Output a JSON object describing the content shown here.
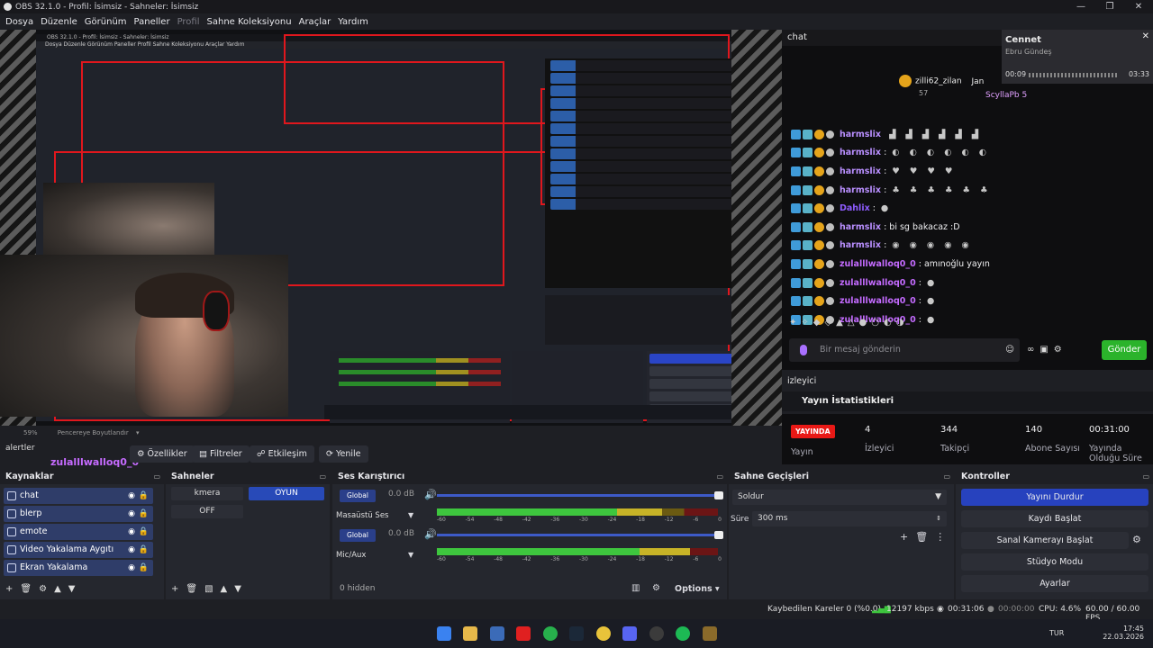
{
  "window": {
    "title": "OBS 32.1.0 - Profil: İsimsiz - Sahneler: İsimsiz",
    "controls": [
      "—",
      "❐",
      "✕"
    ]
  },
  "menu": {
    "items": [
      "Dosya",
      "Düzenle",
      "Görünüm",
      "Paneller",
      "Profil",
      "Sahne Koleksiyonu",
      "Araçlar",
      "Yardım"
    ]
  },
  "preview": {
    "zoom": "59%",
    "zoom_mode": "Pencereye Boyutlandır",
    "nested_title": "OBS 32.1.0 - Profil: İsimsiz - Sahneler: İsimsiz",
    "nested_menu": "Dosya  Düzenle  Görünüm  Paneller  Profil  Sahne Koleksiyonu  Araçlar  Yardım"
  },
  "chat": {
    "header": "chat",
    "popup": {
      "name": "Cennet",
      "artist": "Ebru Gündeş",
      "elapsed": "00:09",
      "total": "03:33"
    },
    "pinned": {
      "user": "zilli62_zilan",
      "count": "57",
      "user2": "ScyllaPb 5",
      "user_partial": "Jan"
    },
    "messages": [
      {
        "user": "harmslix",
        "text": "",
        "emotes": "▟ ▟ ▟ ▟ ▟ ▟",
        "color": "#b98fff"
      },
      {
        "user": "harmslix",
        "text": ":",
        "emotes": "◐ ◐ ◐ ◐ ◐ ◐",
        "color": "#b98fff"
      },
      {
        "user": "harmslix",
        "text": ":",
        "emotes": "♥ ♥ ♥ ♥",
        "color": "#b98fff"
      },
      {
        "user": "harmslix",
        "text": ":",
        "emotes": "♣ ♣ ♣ ♣ ♣ ♣",
        "color": "#b98fff"
      },
      {
        "user": "Dahlix",
        "text": ":",
        "emotes": "●",
        "color": "#8e5cff"
      },
      {
        "user": "harmslix",
        "text": ": bi sg bakacaz :D",
        "emotes": "",
        "color": "#b98fff"
      },
      {
        "user": "harmslix",
        "text": ":",
        "emotes": "◉ ◉ ◉ ◉ ◉",
        "color": "#b98fff"
      },
      {
        "user": "zulalllwalloq0_0",
        "text": ": amınoğlu yayın",
        "emotes": "",
        "color": "#c46bff"
      },
      {
        "user": "zulalllwalloq0_0",
        "text": ":",
        "emotes": "●",
        "color": "#c46bff"
      },
      {
        "user": "zulalllwalloq0_0",
        "text": ":",
        "emotes": "●",
        "color": "#c46bff"
      },
      {
        "user": "zulalllwalloq0_0",
        "text": ":",
        "emotes": "●",
        "color": "#c46bff"
      }
    ],
    "input_placeholder": "Bir mesaj gönderin",
    "send_label": "Gönder"
  },
  "stats": {
    "panel_title": "izleyici",
    "title": "Yayın İstatistikleri",
    "live_label": "YAYINDA",
    "live_sub": "Yayın",
    "viewers": "4",
    "viewers_label": "İzleyici",
    "followers": "344",
    "followers_label": "Takipçi",
    "subs": "140",
    "subs_label": "Abone Sayısı",
    "uptime": "00:31:00",
    "uptime_label": "Yayında Olduğu Süre"
  },
  "toolbar": {
    "source_label": "alertler",
    "source_name": "zulalllwalloq0_0",
    "properties": "Özellikler",
    "filters": "Filtreler",
    "interact": "Etkileşim",
    "refresh": "Yenile"
  },
  "sources": {
    "title": "Kaynaklar",
    "items": [
      "chat",
      "blerp",
      "emote",
      "Video Yakalama Aygıtı",
      "Ekran Yakalama"
    ]
  },
  "scenes": {
    "title": "Sahneler",
    "items": [
      "kmera",
      "OYUN",
      "OFF"
    ]
  },
  "mixer": {
    "title": "Ses Karıştırıcı",
    "channels": [
      {
        "name": "Masaüstü Ses",
        "db": "0.0 dB",
        "global": "Global",
        "level": 0.8
      },
      {
        "name": "Mic/Aux",
        "db": "0.0 dB",
        "global": "Global",
        "level": 0.9
      }
    ],
    "ticks": [
      "-60",
      "-54",
      "-48",
      "-42",
      "-36",
      "-30",
      "-24",
      "-18",
      "-12",
      "-6",
      "0"
    ],
    "hidden": "0 hidden",
    "options": "Options"
  },
  "transitions": {
    "title": "Sahne Geçişleri",
    "selected": "Soldur",
    "duration_label": "Süre",
    "duration": "300 ms"
  },
  "controls": {
    "title": "Kontroller",
    "stop_stream": "Yayını Durdur",
    "start_record": "Kaydı Başlat",
    "virtual_cam": "Sanal Kamerayı Başlat",
    "studio_mode": "Stüdyo Modu",
    "settings": "Ayarlar"
  },
  "status": {
    "dropped": "Kaybedilen Kareler 0 (%0.0)",
    "bitrate": "12197 kbps",
    "stream_time": "00:31:06",
    "rec_time": "00:00:00",
    "cpu": "CPU: 4.6%",
    "fps": "60.00 / 60.00 FPS"
  },
  "taskbar": {
    "lang": "TUR",
    "time": "17:45",
    "date": "22.03.2026"
  }
}
